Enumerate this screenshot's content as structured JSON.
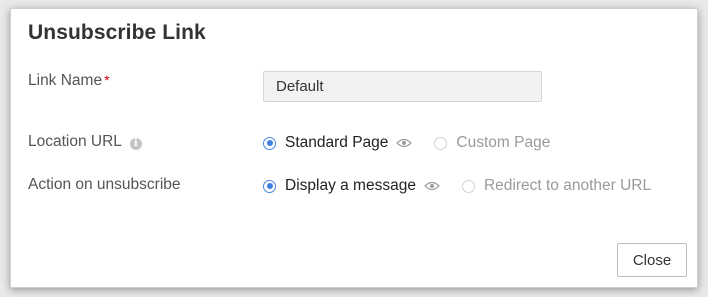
{
  "dialog": {
    "title": "Unsubscribe Link",
    "close_label": "Close"
  },
  "fields": {
    "link_name": {
      "label": "Link Name",
      "required_mark": "*",
      "value": "Default"
    },
    "location_url": {
      "label": "Location URL",
      "info_icon": "i",
      "options": [
        {
          "label": "Standard Page",
          "selected": true
        },
        {
          "label": "Custom Page",
          "selected": false
        }
      ]
    },
    "action": {
      "label": "Action on unsubscribe",
      "options": [
        {
          "label": "Display a message",
          "selected": true
        },
        {
          "label": "Redirect to another URL",
          "selected": false
        }
      ]
    }
  },
  "colors": {
    "accent": "#3f7fe0",
    "required": "#d0021b"
  }
}
